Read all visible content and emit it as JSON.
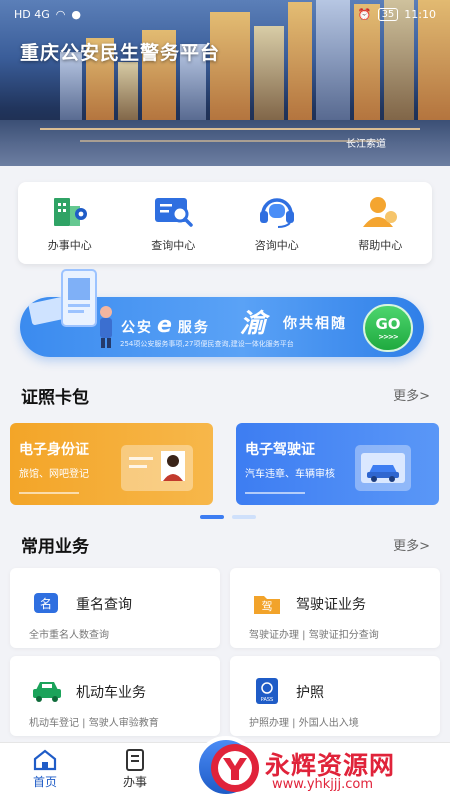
{
  "status": {
    "network": "HD 4G",
    "battery": "35",
    "time": "11:10"
  },
  "hero": {
    "title": "重庆公安民生警务平台",
    "caption": "长江索道"
  },
  "quick_menu": [
    {
      "label": "办事中心",
      "icon": "office-building-icon"
    },
    {
      "label": "查询中心",
      "icon": "search-card-icon"
    },
    {
      "label": "咨询中心",
      "icon": "headset-icon"
    },
    {
      "label": "帮助中心",
      "icon": "helper-user-icon"
    }
  ],
  "banner": {
    "text_left": "公安",
    "text_e": "服务",
    "text_yu": "渝",
    "text_right": "你共相随",
    "subtext": "254项公安服务事项,27项便民查询,建设一体化服务平台",
    "go_label": "GO",
    "go_arrows": ">>>>"
  },
  "license_section": {
    "title": "证照卡包",
    "more": "更多>",
    "cards": [
      {
        "title": "电子身份证",
        "desc": "旅馆、网吧登记"
      },
      {
        "title": "电子驾驶证",
        "desc": "汽车违章、车辆审核"
      }
    ]
  },
  "service_section": {
    "title": "常用业务",
    "more": "更多>",
    "items": [
      {
        "name": "重名查询",
        "desc": "全市重名人数查询",
        "icon_text": "名"
      },
      {
        "name": "驾驶证业务",
        "desc": "驾驶证办理 | 驾驶证扣分查询",
        "icon_text": "驾"
      },
      {
        "name": "机动车业务",
        "desc": "机动车登记 | 驾驶人审验教育",
        "icon_text": ""
      },
      {
        "name": "护照",
        "desc": "护照办理 | 外国人出入境",
        "icon_text": "PASS"
      }
    ]
  },
  "tabbar": {
    "items": [
      {
        "label": "首页"
      },
      {
        "label": "办事"
      }
    ]
  },
  "watermark": {
    "text": "永辉资源网",
    "url": "www.yhkjjj.com"
  },
  "colors": {
    "primary": "#1f5cc7",
    "orange": "#f3a528",
    "green": "#1faa3f"
  }
}
